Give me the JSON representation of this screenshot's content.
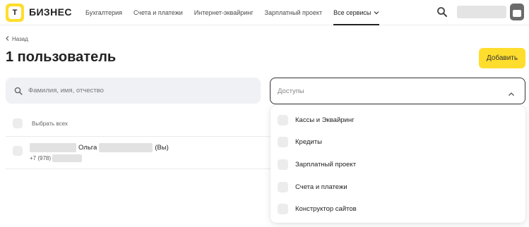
{
  "header": {
    "brand": "БИЗНЕС",
    "logo_letter": "Т",
    "nav": [
      {
        "label": "Бухгалтерия"
      },
      {
        "label": "Счета и платежи"
      },
      {
        "label": "Интернет-эквайринг"
      },
      {
        "label": "Зарплатный проект"
      },
      {
        "label": "Все сервисы"
      }
    ],
    "active_nav": "Все сервисы"
  },
  "page": {
    "back_label": "Назад",
    "title": "1 пользователь",
    "add_button": "Добавить"
  },
  "search": {
    "placeholder": "Фамилия, имя, отчество"
  },
  "access_filter": {
    "placeholder": "Доступы",
    "options": [
      {
        "label": "Кассы и Эквайринг"
      },
      {
        "label": "Кредиты"
      },
      {
        "label": "Зарплатный проект"
      },
      {
        "label": "Счета и платежи"
      },
      {
        "label": "Конструктор сайтов"
      }
    ]
  },
  "list": {
    "select_all_label": "Выбрать всех",
    "users": [
      {
        "first_name": "Ольга",
        "you_badge": "(Вы)",
        "phone_prefix": "+7 (978)"
      }
    ]
  },
  "colors": {
    "accent": "#ffdd2d",
    "search_bg": "#f0f1f5",
    "checkbox_bg": "#ececec"
  }
}
